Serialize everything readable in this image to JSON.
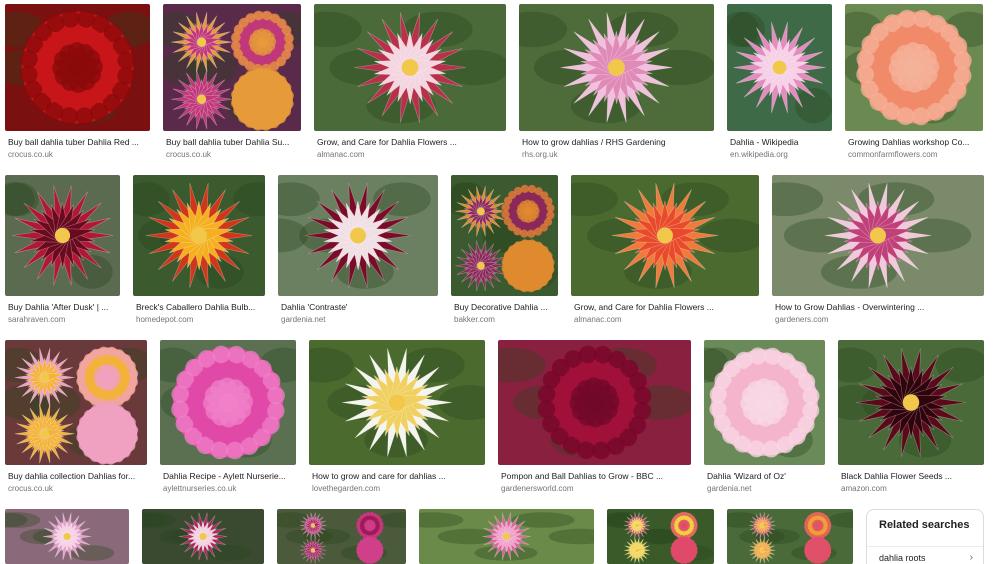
{
  "results": [
    {
      "caption": "Buy ball dahlia tuber Dahlia Red ...",
      "source": "crocus.co.uk",
      "bg": "#7a1010",
      "petal": "#c8161a",
      "center": "#8a0a0a",
      "type": "ball"
    },
    {
      "caption": "Buy ball dahlia tuber Dahlia Su...",
      "source": "crocus.co.uk",
      "bg": "#5a2a4a",
      "petal": "#e69a3a",
      "center": "#c0387a",
      "type": "multi"
    },
    {
      "caption": "Grow, and Care for Dahlia Flowers ...",
      "source": "almanac.com",
      "bg": "#4a6a3a",
      "petal": "#b8304a",
      "center": "#f3d6e0",
      "type": "spiky"
    },
    {
      "caption": "How to grow dahlias / RHS Gardening",
      "source": "rhs.org.uk",
      "bg": "#4e6b3a",
      "petal": "#f0c0dc",
      "center": "#e08ab8",
      "type": "spiky"
    },
    {
      "caption": "Dahlia - Wikipedia",
      "source": "en.wikipedia.org",
      "bg": "#3f6a48",
      "petal": "#e48cc0",
      "center": "#f6d0e6",
      "type": "spiky"
    },
    {
      "caption": "Growing Dahlias workshop Co...",
      "source": "commonfarmflowers.com",
      "bg": "#6b8a52",
      "petal": "#f08a6a",
      "center": "#f5b29a",
      "type": "ball"
    },
    {
      "caption": "Buy Dahlia 'After Dusk' | ...",
      "source": "sarahraven.com",
      "bg": "#5b6b50",
      "petal": "#b01836",
      "center": "#6a0a1e",
      "type": "spiky"
    },
    {
      "caption": "Breck's Caballero Dahlia Bulb...",
      "source": "homedepot.com",
      "bg": "#3b5a2e",
      "petal": "#d2361a",
      "center": "#f5b020",
      "type": "spiky"
    },
    {
      "caption": "Dahlia 'Contraste'",
      "source": "gardenia.net",
      "bg": "#6b8060",
      "petal": "#7a0c2a",
      "center": "#f0e0e6",
      "type": "spiky"
    },
    {
      "caption": "Buy Decorative Dahlia ...",
      "source": "bakker.com",
      "bg": "#3c5a30",
      "petal": "#e08a30",
      "center": "#8a2a5a",
      "type": "multi"
    },
    {
      "caption": "Grow, and Care for Dahlia Flowers ...",
      "source": "almanac.com",
      "bg": "#4a6a30",
      "petal": "#f07a3a",
      "center": "#e84a2a",
      "type": "spiky"
    },
    {
      "caption": "How to Grow Dahlias - Overwintering ...",
      "source": "gardeners.com",
      "bg": "#7a8a6a",
      "petal": "#f2c8dc",
      "center": "#c0407a",
      "type": "spiky"
    },
    {
      "caption": "Buy dahlia collection Dahlias for...",
      "source": "crocus.co.uk",
      "bg": "#6a3a3a",
      "petal": "#f0a0c0",
      "center": "#f3b23a",
      "type": "multi"
    },
    {
      "caption": "Dahlia Recipe - Aylett Nurserie...",
      "source": "aylettnurseries.co.uk",
      "bg": "#5a7050",
      "petal": "#e04aa8",
      "center": "#f080c8",
      "type": "ball"
    },
    {
      "caption": "How to grow and care for dahlias ...",
      "source": "lovethegarden.com",
      "bg": "#4a6a2e",
      "petal": "#f5f5f0",
      "center": "#f0d060",
      "type": "spiky"
    },
    {
      "caption": "Pompon and Ball Dahlias to Grow - BBC ...",
      "source": "gardenersworld.com",
      "bg": "#8a2040",
      "petal": "#a0103a",
      "center": "#70082a",
      "type": "ball"
    },
    {
      "caption": "Dahlia 'Wizard of Oz'",
      "source": "gardenia.net",
      "bg": "#6a8a5a",
      "petal": "#f4b4cc",
      "center": "#f8d8e4",
      "type": "ball"
    },
    {
      "caption": "Black Dahlia Flower Seeds ...",
      "source": "amazon.com",
      "bg": "#4a6a3a",
      "petal": "#5a0a1a",
      "center": "#30040c",
      "type": "spiky"
    },
    {
      "caption": "",
      "source": "",
      "bg": "#8a6a7a",
      "petal": "#e8a0cc",
      "center": "#f6d0e4",
      "type": "spiky"
    },
    {
      "caption": "",
      "source": "",
      "bg": "#3a4a30",
      "petal": "#b0205a",
      "center": "#f0d0e0",
      "type": "spiky"
    },
    {
      "caption": "",
      "source": "",
      "bg": "#4a5a3a",
      "petal": "#d0408a",
      "center": "#a01a5a",
      "type": "multi"
    },
    {
      "caption": "",
      "source": "",
      "bg": "#6a8a4a",
      "petal": "#e060a0",
      "center": "#f0a0c8",
      "type": "spiky"
    },
    {
      "caption": "",
      "source": "",
      "bg": "#3a5a2a",
      "petal": "#e04a6a",
      "center": "#f0d040",
      "type": "multi"
    },
    {
      "caption": "",
      "source": "",
      "bg": "#4a6a3a",
      "petal": "#e0506a",
      "center": "#f0a030",
      "type": "multi"
    }
  ],
  "related": {
    "title": "Related searches",
    "items": [
      {
        "label": "dahlia roots"
      }
    ]
  },
  "icons": {
    "chevron": "›"
  }
}
